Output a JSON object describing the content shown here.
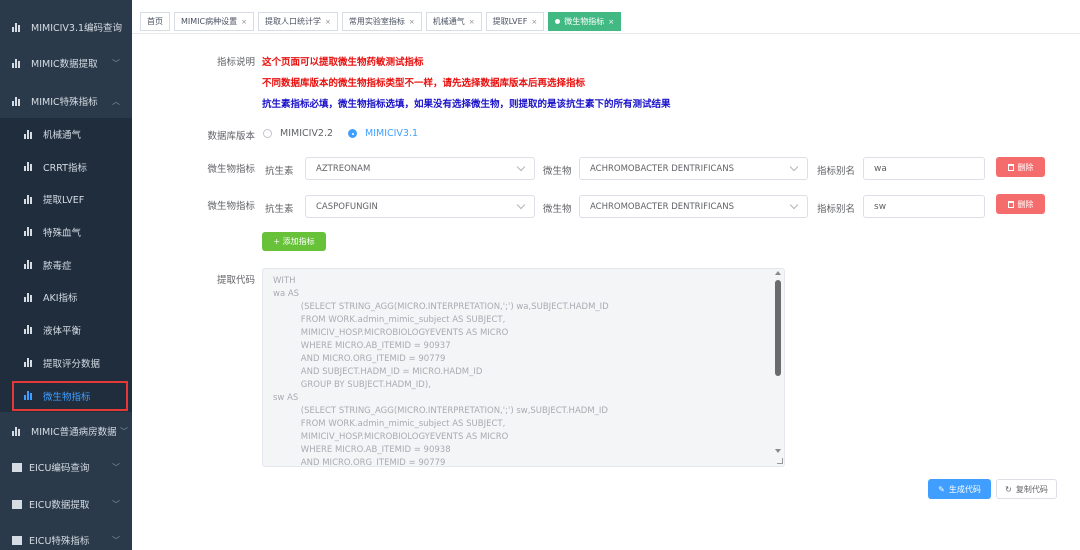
{
  "sidebar": {
    "items": [
      {
        "label": "MIMICIV3.1编码查询",
        "arrow": ""
      },
      {
        "label": "MIMIC数据提取",
        "arrow": "﹀"
      },
      {
        "label": "MIMIC特殊指标",
        "arrow": "︿"
      },
      {
        "label": "机械通气"
      },
      {
        "label": "CRRT指标"
      },
      {
        "label": "提取LVEF"
      },
      {
        "label": "特殊血气"
      },
      {
        "label": "脓毒症"
      },
      {
        "label": "AKI指标"
      },
      {
        "label": "液体平衡"
      },
      {
        "label": "提取评分数据"
      },
      {
        "label": "微生物指标"
      },
      {
        "label": "MIMIC普通病房数据",
        "arrow": "﹀"
      },
      {
        "label": "EICU编码查询",
        "arrow": "﹀"
      },
      {
        "label": "EICU数据提取",
        "arrow": "﹀"
      },
      {
        "label": "EICU特殊指标",
        "arrow": "﹀"
      }
    ]
  },
  "tabs": [
    {
      "label": "首页",
      "closable": false
    },
    {
      "label": "MIMIC病种设置",
      "closable": true
    },
    {
      "label": "提取人口统计学",
      "closable": true
    },
    {
      "label": "常用实验室指标",
      "closable": true
    },
    {
      "label": "机械通气",
      "closable": true
    },
    {
      "label": "提取LVEF",
      "closable": true
    },
    {
      "label": "微生物指标",
      "closable": true,
      "active": true
    }
  ],
  "form": {
    "desc_label": "指标说明",
    "notes": [
      "这个页面可以提取微生物药敏测试指标",
      "不同数据库版本的微生物指标类型不一样，请先选择数据库版本后再选择指标",
      "抗生素指标必填，微生物指标选填，如果没有选择微生物，则提取的是该抗生素下的所有测试结果"
    ],
    "db_label": "数据库版本",
    "db_options": [
      "MIMICIV2.2",
      "MIMICIV3.1"
    ],
    "db_selected": "MIMICIV3.1",
    "rows": [
      {
        "label": "微生物指标",
        "antibiotic_label": "抗生素",
        "antibiotic": "AZTREONAM",
        "microbe_label": "微生物",
        "microbe": "ACHROMOBACTER DENTRIFICANS",
        "alias_label": "指标别名",
        "alias": "wa",
        "delete_label": "删除"
      },
      {
        "label": "微生物指标",
        "antibiotic_label": "抗生素",
        "antibiotic": "CASPOFUNGIN",
        "microbe_label": "微生物",
        "microbe": "ACHROMOBACTER DENTRIFICANS",
        "alias_label": "指标别名",
        "alias": "sw",
        "delete_label": "删除"
      }
    ],
    "add_label": "+ 添加指标",
    "code_label": "提取代码",
    "code_lines": [
      "WITH",
      "wa AS",
      "    (SELECT STRING_AGG(MICRO.INTERPRETATION,';') wa,SUBJECT.HADM_ID",
      "    FROM WORK.admin_mimic_subject AS SUBJECT,",
      "    MIMICIV_HOSP.MICROBIOLOGYEVENTS AS MICRO",
      "    WHERE MICRO.AB_ITEMID = 90937",
      "    AND MICRO.ORG_ITEMID = 90779",
      "    AND SUBJECT.HADM_ID = MICRO.HADM_ID",
      "    GROUP BY SUBJECT.HADM_ID),",
      "sw AS",
      "    (SELECT STRING_AGG(MICRO.INTERPRETATION,';') sw,SUBJECT.HADM_ID",
      "    FROM WORK.admin_mimic_subject AS SUBJECT,",
      "    MIMICIV_HOSP.MICROBIOLOGYEVENTS AS MICRO",
      "    WHERE MICRO.AB_ITEMID = 90938",
      "    AND MICRO.ORG_ITEMID = 90779"
    ],
    "generate_label": "生成代码",
    "copy_label": "复制代码"
  }
}
